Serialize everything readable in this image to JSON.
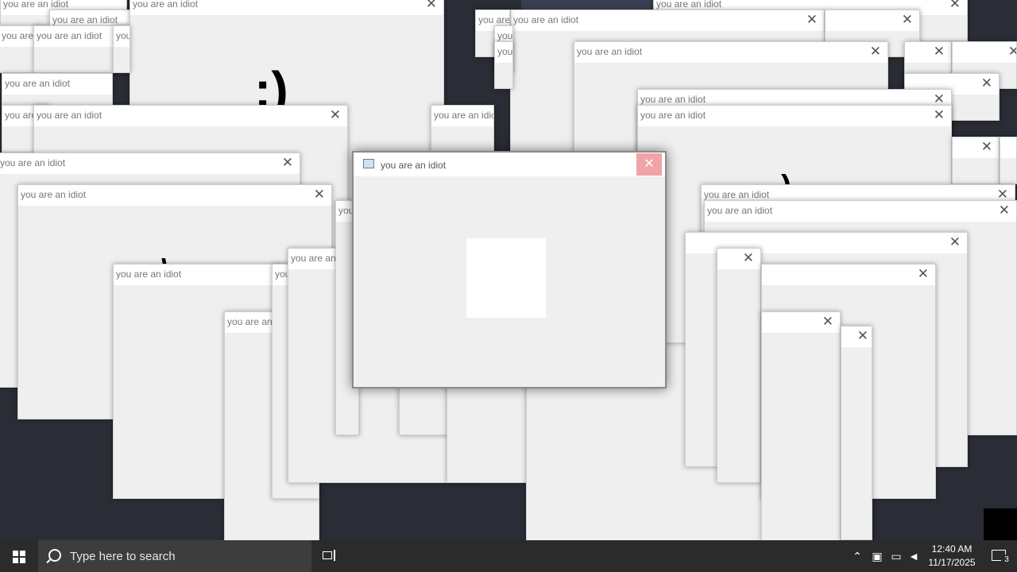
{
  "windows": [
    {
      "title": "you are an idiot"
    },
    {
      "title": "you are an idiot"
    },
    {
      "title": "you are an idiot"
    },
    {
      "title": "you are an idiot"
    },
    {
      "title": "you are an idiot"
    },
    {
      "title": "you are an idiot"
    },
    {
      "title": "you are an idiot"
    },
    {
      "title": "you are an idiot"
    },
    {
      "title": "you are an idiot"
    },
    {
      "title": "you are an idiot"
    },
    {
      "title": "you are an idiot"
    },
    {
      "title": "you are an idiot"
    },
    {
      "title": "you are an idiot"
    },
    {
      "title": "you are an idiot"
    },
    {
      "title": "you are an idiot"
    },
    {
      "title": "you are an idiot"
    },
    {
      "title": "you are an idiot"
    },
    {
      "title": "you are an idiot"
    },
    {
      "title": "you are an idiot"
    },
    {
      "title": "you are an idiot"
    },
    {
      "title": "you are an idiot"
    },
    {
      "title": "you are an idiot"
    },
    {
      "title": "you are an idiot"
    },
    {
      "title": "you are an idiot"
    },
    {
      "title": "you are an idiot"
    },
    {
      "title": "you are an idiot"
    },
    {
      "title": "you are an idiot"
    }
  ],
  "close_glyph": "✕",
  "active_window": {
    "title": "you are an idiot",
    "close_glyph": "✕",
    "close_hover_color": "#f2a3a8"
  },
  "face_fragments": [
    ":)",
    ")",
    "\\"
  ],
  "taskbar": {
    "search_placeholder": "Type here to search",
    "time": "12:40 AM",
    "date": "11/17/2025",
    "notification_count": "3",
    "tray_icons": [
      "chevron-up-icon",
      "security-icon",
      "network-icon",
      "volume-muted-icon"
    ]
  }
}
